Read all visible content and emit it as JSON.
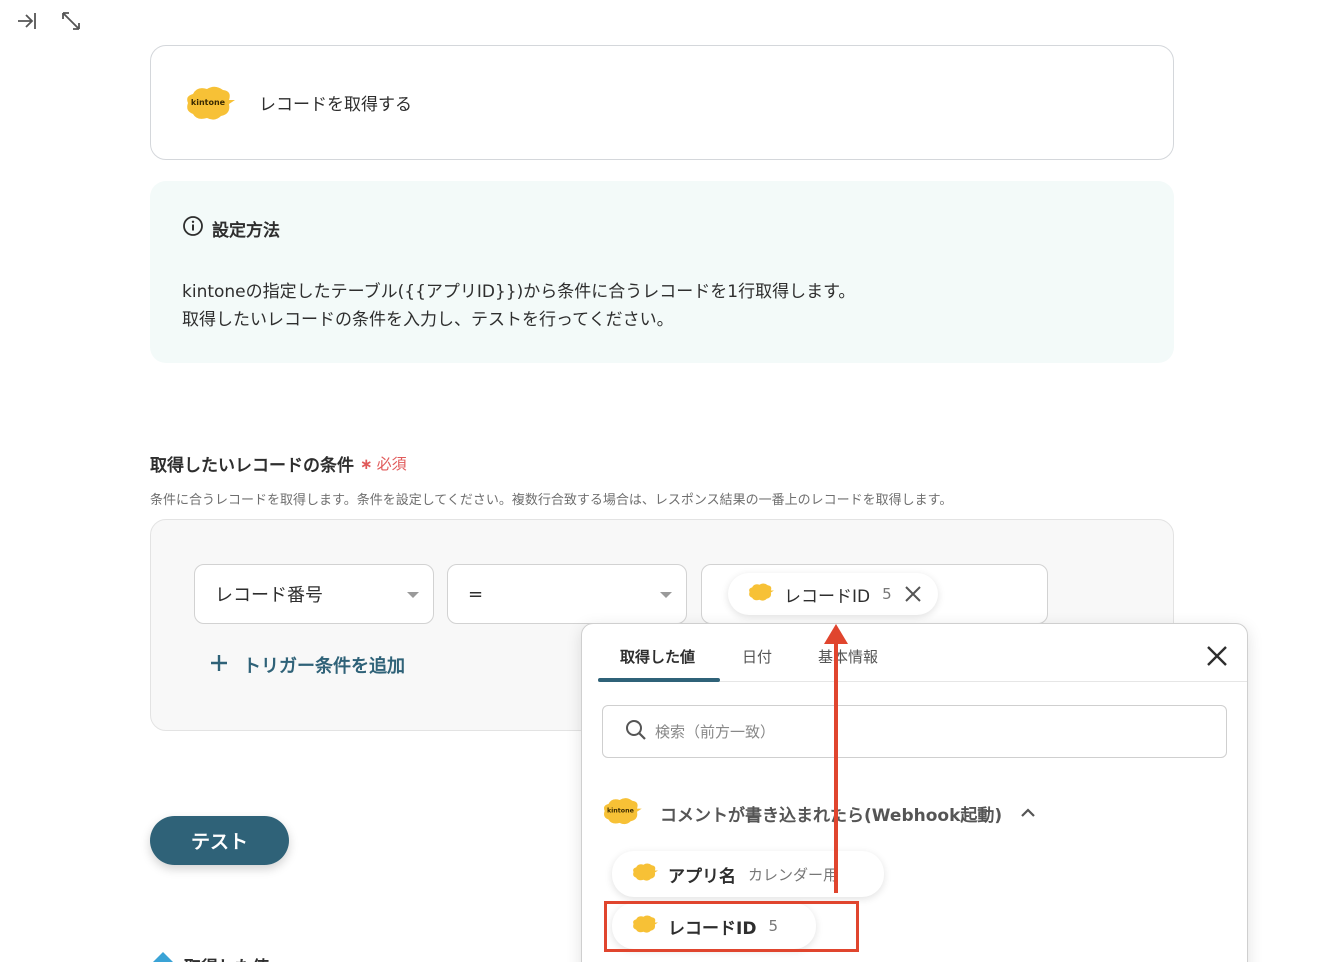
{
  "header": {
    "title": "レコードを取得する",
    "logo_text": "kintone"
  },
  "info": {
    "title": "設定方法",
    "line1": "kintoneの指定したテーブル({{アプリID}})から条件に合うレコードを1行取得します。",
    "line2": "取得したいレコードの条件を入力し、テストを行ってください。"
  },
  "condition": {
    "label": "取得したいレコードの条件",
    "required_mark": "∗",
    "required_text": "必須",
    "description": "条件に合うレコードを取得します。条件を設定してください。複数行合致する場合は、レスポンス結果の一番上のレコードを取得します。",
    "field_select": "レコード番号",
    "operator_select": "=",
    "value_chip": {
      "label": "レコードID",
      "value": "5"
    },
    "add_label": "トリガー条件を追加"
  },
  "test_button": "テスト",
  "got_values_label": "取得した値",
  "popup": {
    "tabs": [
      "取得した値",
      "日付",
      "基本情報"
    ],
    "search_placeholder": "検索（前方一致）",
    "group_title": "コメントが書き込まれたら(Webhook起動)",
    "items": [
      {
        "label": "アプリ名",
        "value": "カレンダー用"
      },
      {
        "label": "レコードID",
        "value": "5"
      }
    ]
  },
  "colors": {
    "accent": "#2f6278",
    "required": "#e05a5a",
    "annotation": "#e0452e",
    "kintone_yellow": "#f7c136"
  }
}
